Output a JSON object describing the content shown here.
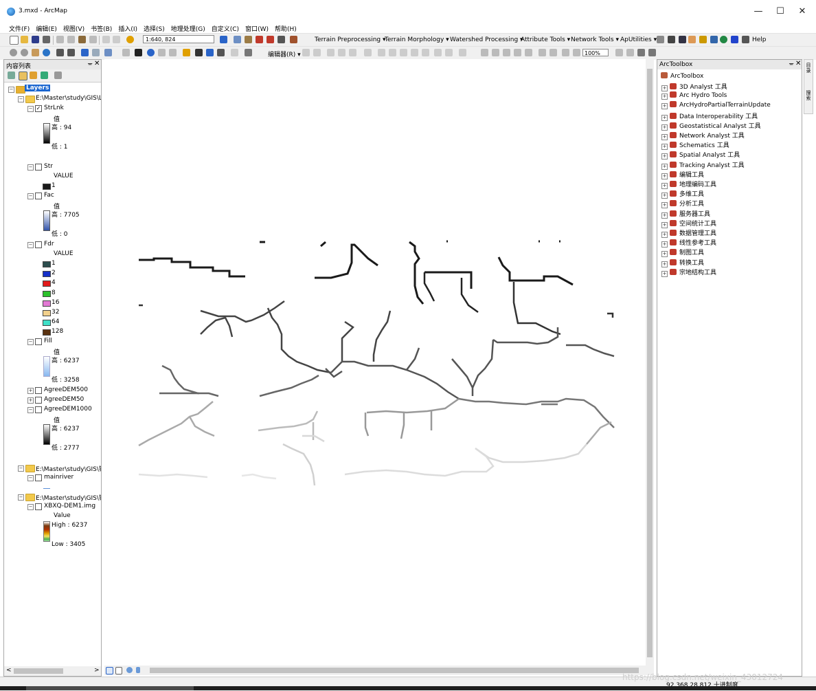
{
  "window": {
    "title": "3.mxd - ArcMap",
    "minimize": "—",
    "maximize": "☐",
    "close": "✕"
  },
  "menu": [
    "文件(F)",
    "编辑(E)",
    "视图(V)",
    "书签(B)",
    "插入(I)",
    "选择(S)",
    "地理处理(G)",
    "自定义(C)",
    "窗口(W)",
    "帮助(H)"
  ],
  "toolbar1": {
    "scale": "1:640, 824",
    "tools": [
      "Terrain Preprocessing ▾",
      "Terrain Morphology ▾",
      "Watershed Processing ▾",
      "Attribute Tools ▾",
      "Network Tools ▾",
      "ApUtilities ▾"
    ],
    "help": "Help"
  },
  "toolbar2": {
    "editor": "编辑器(R) ▾",
    "zoom": "100%"
  },
  "toc": {
    "title": "内容列表",
    "pin": "ᚚ",
    "close": "✕",
    "hscroll_left": "<",
    "hscroll_right": ">",
    "root": "Layers",
    "group1": "E:\\Master\\study\\GIS\\La",
    "strlnk": {
      "name": "StrLnk",
      "checked": "✓",
      "field": "值",
      "high": "高 : 94",
      "low": "低 : 1"
    },
    "str": {
      "name": "Str",
      "field": "VALUE",
      "items": [
        {
          "label": "1",
          "color": "#1a1a1a"
        }
      ]
    },
    "fac": {
      "name": "Fac",
      "field": "值",
      "high": "高 : 7705",
      "low": "低 : 0"
    },
    "fdr": {
      "name": "Fdr",
      "field": "VALUE",
      "items": [
        {
          "label": "1",
          "color": "#2d4e4e"
        },
        {
          "label": "2",
          "color": "#1530c8"
        },
        {
          "label": "4",
          "color": "#e21b1b"
        },
        {
          "label": "8",
          "color": "#2cc12c"
        },
        {
          "label": "16",
          "color": "#e27ad5"
        },
        {
          "label": "32",
          "color": "#f2d08c"
        },
        {
          "label": "64",
          "color": "#3fe0c8"
        },
        {
          "label": "128",
          "color": "#5a3210"
        }
      ]
    },
    "fill": {
      "name": "Fill",
      "field": "值",
      "high": "高 : 6237",
      "low": "低 : 3258"
    },
    "agree500": "AgreeDEM500",
    "agree50": "AgreeDEM50",
    "agree1000": {
      "name": "AgreeDEM1000",
      "field": "值",
      "high": "高 : 6237",
      "low": "低 : 2777"
    },
    "group2": "E:\\Master\\study\\GIS\\错",
    "mainriver": "mainriver",
    "group3": "E:\\Master\\study\\GIS\\错",
    "dem": {
      "name": "XBXQ-DEM1.img",
      "field": "Value",
      "high": "High : 6237",
      "low": "Low : 3405"
    }
  },
  "toolbox": {
    "title": "ArcToolbox",
    "pin": "ᚚ",
    "close": "✕",
    "root": "ArcToolbox",
    "items": [
      "3D Analyst 工具",
      "Arc Hydro Tools",
      "ArcHydroPartialTerrainUpdate",
      "Data Interoperability 工具",
      "Geostatistical Analyst 工具",
      "Network Analyst 工具",
      "Schematics 工具",
      "Spatial Analyst 工具",
      "Tracking Analyst 工具",
      "编辑工具",
      "地理编码工具",
      "多维工具",
      "分析工具",
      "服务器工具",
      "空间统计工具",
      "数据管理工具",
      "线性参考工具",
      "制图工具",
      "转换工具",
      "宗地结构工具"
    ]
  },
  "side_tabs": [
    "目录",
    "搜索"
  ],
  "status": {
    "coords": "92.368  28.812 十进制度"
  },
  "watermark": "https://blog.csdn.net/weixin_43012724"
}
